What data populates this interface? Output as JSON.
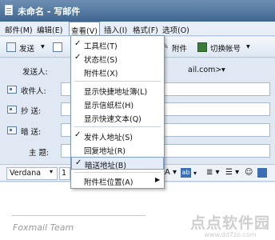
{
  "window": {
    "title": "未命名 - 写邮件",
    "doc_icon": "document-icon"
  },
  "menubar": {
    "items": [
      "邮件(M)",
      "编辑(E)",
      "查看(V)",
      "插入(I)",
      "格式(F)",
      "选项(O)"
    ],
    "active": "查看(V)"
  },
  "toolbar": {
    "send_label": "发送",
    "send_arrow": "▾",
    "attach_label": "附件",
    "switch_account_label": "切换帐号",
    "switch_arrow": "▾",
    "icons": [
      "send-icon",
      "save-icon",
      "paperclip-icon",
      "switch-account-icon"
    ]
  },
  "header": {
    "from_label": "发送人:",
    "from_value_tail": "ail.com>",
    "from_arrow": "▾",
    "to_label": "收件人:",
    "cc_label": "抄  送:",
    "bcc_label": "暗  送:",
    "subject_label": "主  题:"
  },
  "format_bar": {
    "font": "Verdana",
    "font_arrow": "▾",
    "size": "1",
    "icons_text": "A ▾",
    "highlight": "ab",
    "highlight_arrow": "▾",
    "align": "≣ ▾",
    "list": "☰ ▾",
    "emoji": "☺"
  },
  "dropdown": {
    "items": [
      {
        "label": "工具栏(T)",
        "checked": true
      },
      {
        "label": "状态栏(S)",
        "checked": true
      },
      {
        "label": "附件栏(X)",
        "checked": false
      },
      {
        "label": "显示快捷地址簿(L)",
        "checked": false
      },
      {
        "label": "显示信纸栏(H)",
        "checked": false
      },
      {
        "label": "显示快速文本(Q)",
        "checked": false
      },
      {
        "label": "发件人地址(S)",
        "checked": true
      },
      {
        "label": "回复地址(R)",
        "checked": false
      },
      {
        "label": "暗送地址(B)",
        "checked": true,
        "highlighted": true
      },
      {
        "label": "附件栏位置(A)",
        "checked": false,
        "submenu": true
      }
    ],
    "check_glyph": "✓",
    "submenu_glyph": "▶"
  },
  "body": {
    "signature": "Foxmail Team",
    "watermark_main": "点点软件园",
    "watermark_url": "www.dd7zo.com"
  },
  "colors": {
    "title_gradient_top": "#6e8fb3",
    "menu_bg": "#e7eef7",
    "highlight_bg": "#e3ecf8",
    "highlight_border": "#7fa0c9"
  }
}
